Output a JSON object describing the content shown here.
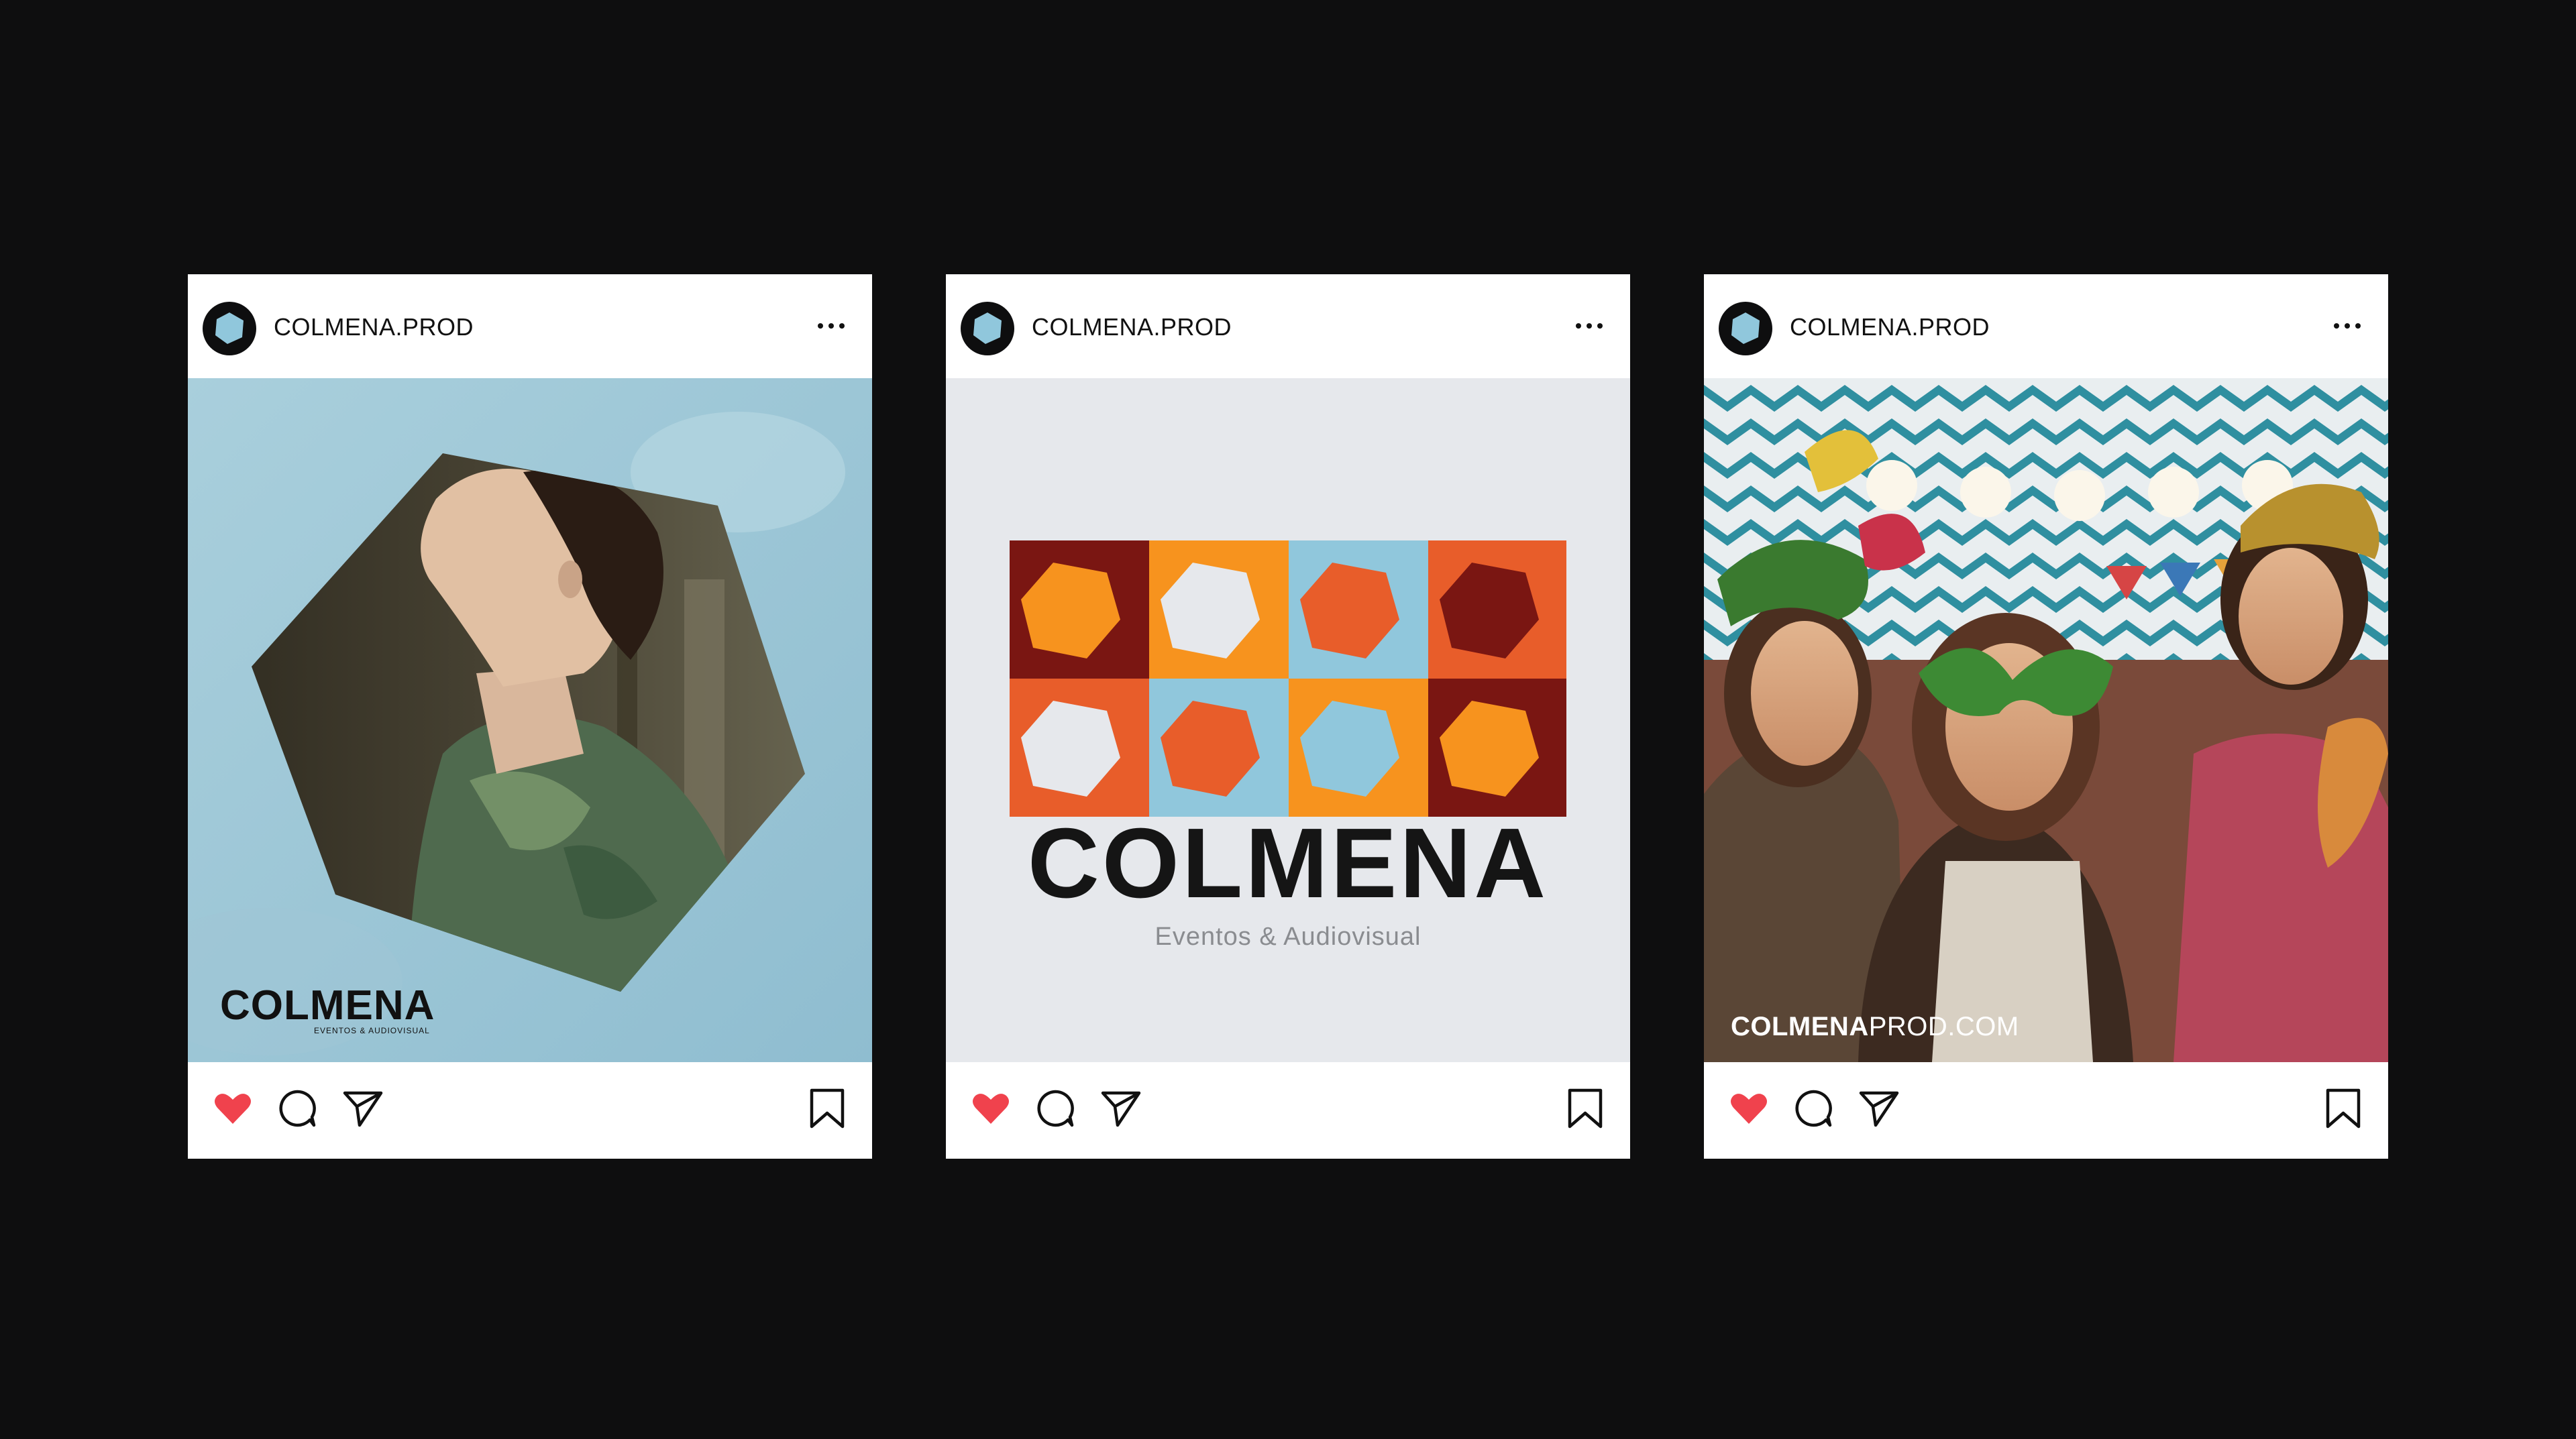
{
  "posts": [
    {
      "username": "COLMENA.PROD",
      "overlay_logo": "COLMENA",
      "overlay_sub": "EVENTOS & AUDIOVISUAL"
    },
    {
      "username": "COLMENA.PROD",
      "logo_word": "COLMENA",
      "tagline": "Eventos & Audiovisual"
    },
    {
      "username": "COLMENA.PROD",
      "overlay_brand": "COLMENA",
      "overlay_domain": "PROD.COM"
    }
  ],
  "icons": [
    "avatar-hexagon-icon",
    "more-dots-icon",
    "heart-icon",
    "comment-icon",
    "share-icon",
    "bookmark-icon"
  ],
  "colors": {
    "background": "#0e0e0f",
    "like_red": "#f0424d",
    "sky_blue": "#90c7dc",
    "orange": "#f7931e",
    "red_orange": "#e85d2a",
    "maroon": "#7a1612",
    "pale_gray": "#e6e8ec"
  }
}
